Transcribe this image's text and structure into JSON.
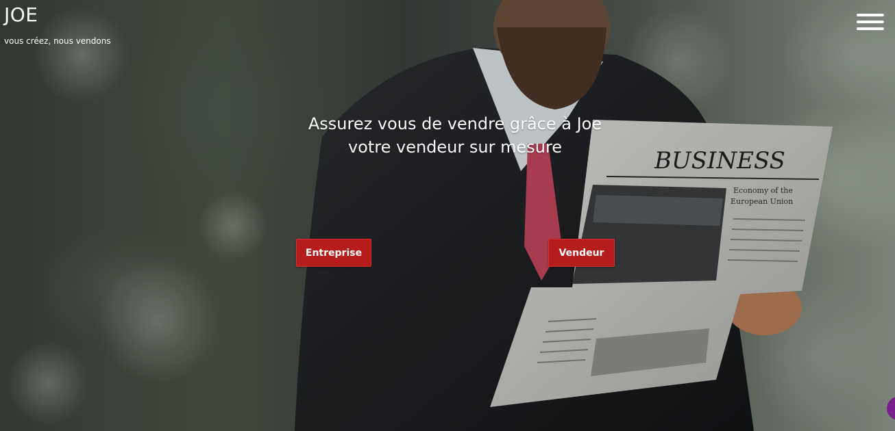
{
  "brand": {
    "title": "JOE",
    "tagline": "vous créez, nous vendons"
  },
  "header": {
    "menu_icon": "hamburger-menu-icon"
  },
  "hero": {
    "headline_line1": "Assurez vous de vendre grâce à Joe",
    "headline_line2": "votre vendeur sur mesure",
    "background_image": "man-reading-business-newspaper",
    "newspaper_masthead": "BUSINESS",
    "newspaper_subhead_line1": "Economy of the",
    "newspaper_subhead_line2": "European Union"
  },
  "cta": {
    "entreprise_label": "Entreprise",
    "vendeur_label": "Vendeur"
  },
  "widgets": {
    "chat_icon": "chat-bubble-icon"
  },
  "colors": {
    "button_bg": "#b71c1c",
    "text": "#ffffff",
    "chat_bubble": "#7a1f8e"
  }
}
